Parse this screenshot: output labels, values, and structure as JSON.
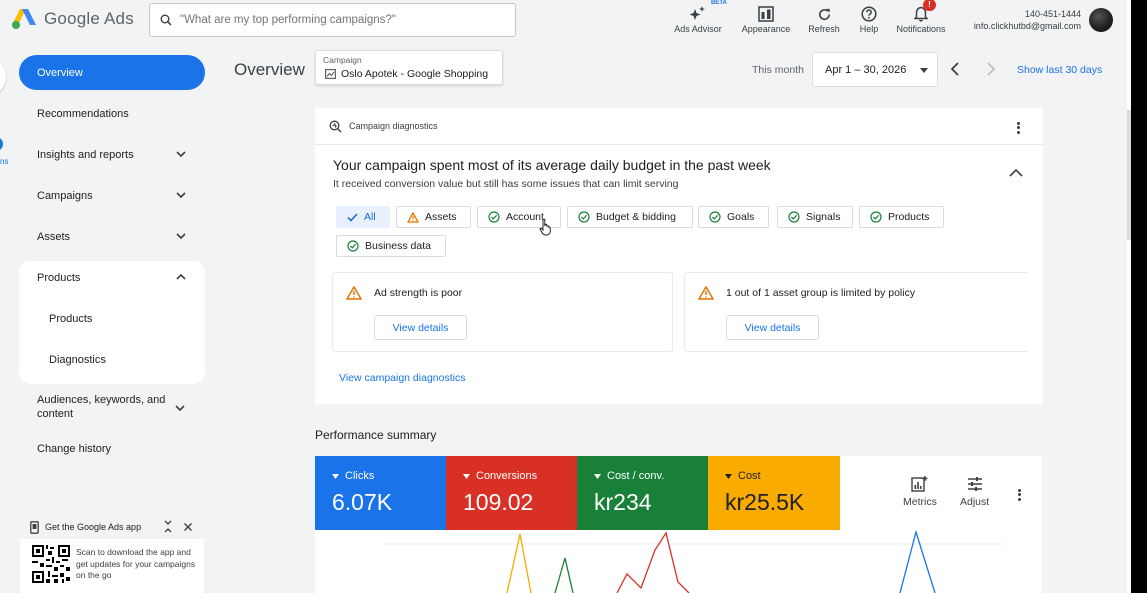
{
  "header": {
    "product_name": "Google Ads",
    "search_placeholder": "\"What are my top performing campaigns?\"",
    "tools": [
      {
        "label": "Ads Advisor",
        "icon": "sparkle-icon"
      },
      {
        "label": "Appearance",
        "icon": "appearance-icon"
      },
      {
        "label": "Refresh",
        "icon": "refresh-icon"
      },
      {
        "label": "Help",
        "icon": "help-icon"
      },
      {
        "label": "Notifications",
        "icon": "bell-icon"
      }
    ],
    "beta_label": "BETA",
    "notification_count": "!",
    "account_id": "140-451-1444",
    "account_email": "info.clickhutbd@gmail.com"
  },
  "sidebar": {
    "items": [
      {
        "label": "Overview"
      },
      {
        "label": "Recommendations"
      },
      {
        "label": "Insights and reports"
      },
      {
        "label": "Campaigns"
      },
      {
        "label": "Assets"
      },
      {
        "label": "Products"
      }
    ],
    "products_subitems": [
      "Products",
      "Diagnostics"
    ],
    "audiences_label": "Audiences, keywords, and content",
    "change_history_label": "Change history",
    "rail_label": "ns"
  },
  "app_promo": {
    "title": "Get the Google Ads app",
    "text": "Scan to download the app and get updates for your campaigns on the go"
  },
  "topbar": {
    "page_title": "Overview",
    "campaign_label": "Campaign",
    "campaign_name": "Oslo Apotek - Google Shopping",
    "date_label": "This month",
    "date_range": "Apr 1 – 30, 2026",
    "show_last": "Show last 30 days"
  },
  "diagnostics": {
    "header": "Campaign diagnostics",
    "title": "Your campaign spent most of its average daily budget in the past week",
    "subtitle": "It received conversion value but still has some issues that can limit serving",
    "filters": [
      "All",
      "Assets",
      "Account",
      "Budget & bidding",
      "Goals",
      "Signals",
      "Products",
      "Business data"
    ],
    "issues": [
      {
        "text": "Ad strength is poor",
        "button": "View details"
      },
      {
        "text": "1 out of 1 asset group is limited by policy",
        "button": "View details"
      }
    ],
    "link": "View campaign diagnostics"
  },
  "performance": {
    "title": "Performance summary",
    "metrics": [
      {
        "name": "Clicks",
        "value": "6.07K",
        "color": "#1a73e8"
      },
      {
        "name": "Conversions",
        "value": "109.02",
        "color": "#d93025"
      },
      {
        "name": "Cost / conv.",
        "value": "kr234",
        "color": "#188038"
      },
      {
        "name": "Cost",
        "value": "kr25.5K",
        "color": "#f9ab00"
      }
    ],
    "metrics_label": "Metrics",
    "adjust_label": "Adjust"
  }
}
